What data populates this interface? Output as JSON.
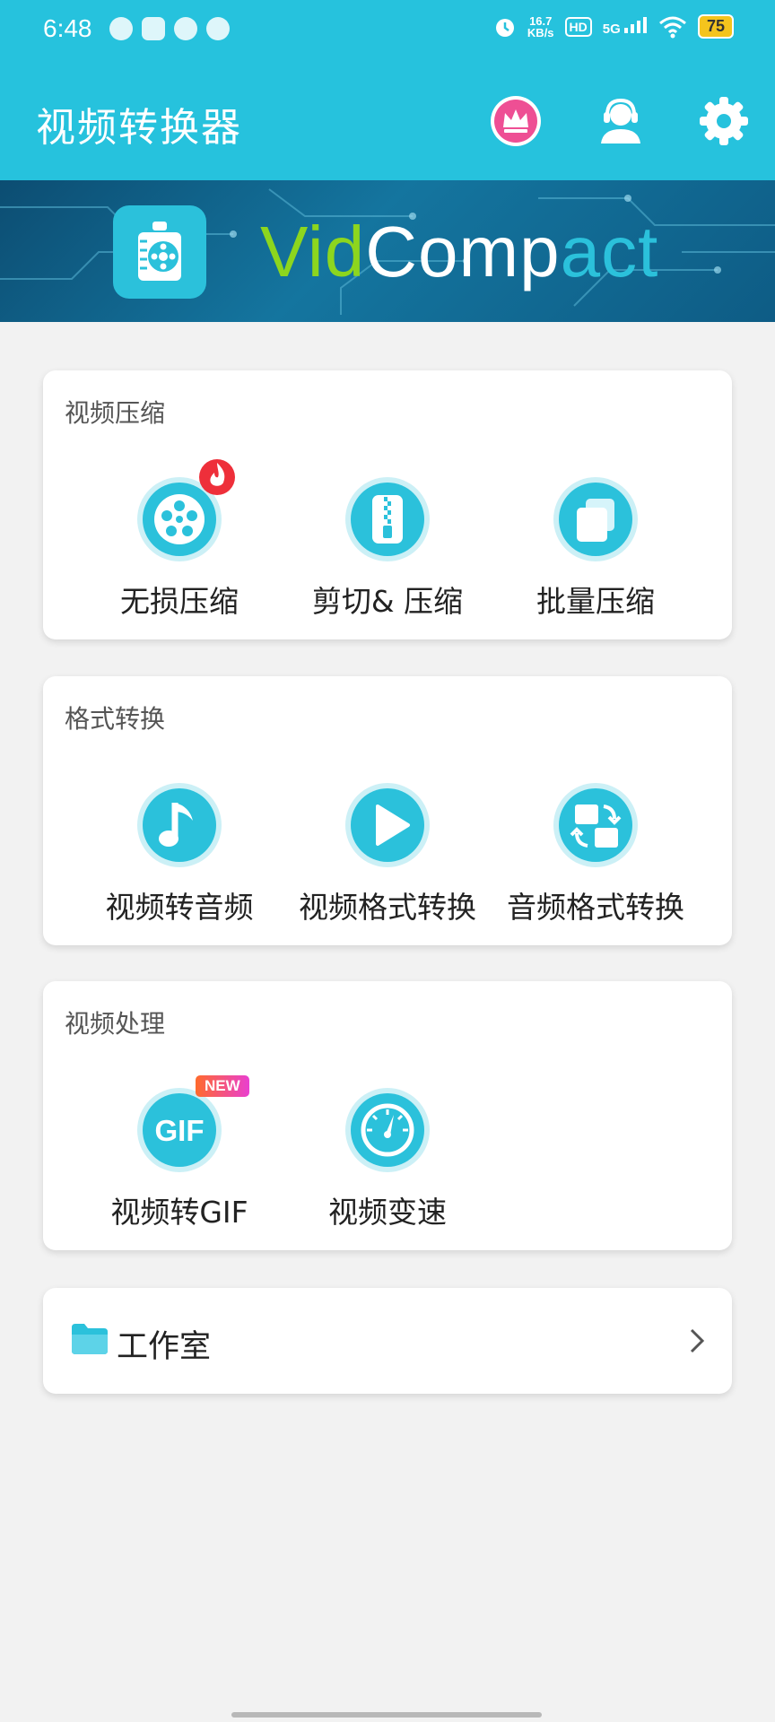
{
  "status_bar": {
    "time": "6:48",
    "net_speed_value": "16.7",
    "net_speed_unit": "KB/s",
    "hd_label": "HD",
    "signal_label": "5G",
    "battery_level": "75"
  },
  "app_bar": {
    "title": "视频转换器",
    "icons": [
      "crown-icon",
      "support-icon",
      "settings-icon"
    ]
  },
  "banner": {
    "brand_vid": "Vid",
    "brand_comp": "Comp",
    "brand_act": "act"
  },
  "sections": [
    {
      "title": "视频压缩",
      "items": [
        {
          "label": "无损压缩",
          "icon": "film-reel-icon",
          "badge": "hot"
        },
        {
          "label": "剪切& 压缩",
          "icon": "zip-icon"
        },
        {
          "label": "批量压缩",
          "icon": "stack-icon"
        }
      ]
    },
    {
      "title": "格式转换",
      "items": [
        {
          "label": "视频转音频",
          "icon": "music-note-icon"
        },
        {
          "label": "视频格式转换",
          "icon": "play-icon"
        },
        {
          "label": "音频格式转换",
          "icon": "swap-icon"
        }
      ]
    },
    {
      "title": "视频处理",
      "items": [
        {
          "label": "视频转GIF",
          "icon": "gif-icon",
          "badge_text": "NEW",
          "icon_text": "GIF"
        },
        {
          "label": "视频变速",
          "icon": "speedometer-icon"
        }
      ]
    }
  ],
  "studio": {
    "label": "工作室",
    "icon": "folder-icon"
  },
  "colors": {
    "primary": "#26c2dd",
    "background": "#f2f2f2",
    "crown_pink": "#ee4f94",
    "brand_green": "#8dd61e"
  }
}
